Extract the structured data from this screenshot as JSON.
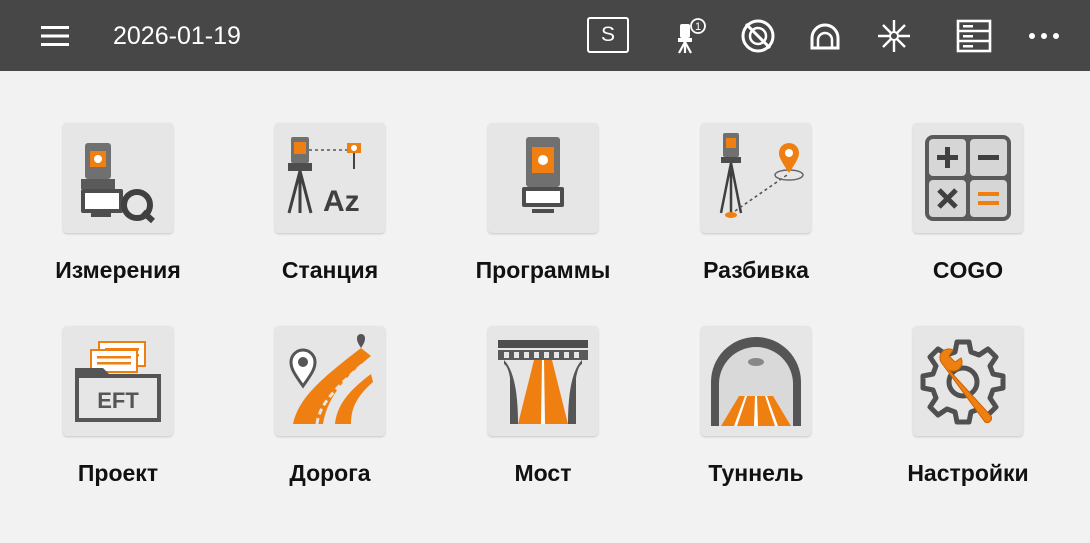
{
  "header": {
    "date": "2026-01-19",
    "s_badge": "S",
    "icons": [
      "menu-icon",
      "laser-pointer-icon",
      "compensator-off-icon",
      "prism-icon",
      "laser-plummet-icon",
      "storage-icon",
      "more-icon"
    ],
    "superscript": "1"
  },
  "tiles": [
    {
      "label": "Измерения",
      "icon": "measure-icon"
    },
    {
      "label": "Станция",
      "icon": "station-icon"
    },
    {
      "label": "Программы",
      "icon": "programs-icon"
    },
    {
      "label": "Разбивка",
      "icon": "stakeout-icon"
    },
    {
      "label": "COGO",
      "icon": "cogo-icon"
    },
    {
      "label": "Проект",
      "icon": "project-icon"
    },
    {
      "label": "Дорога",
      "icon": "road-icon"
    },
    {
      "label": "Мост",
      "icon": "bridge-icon"
    },
    {
      "label": "Туннель",
      "icon": "tunnel-icon"
    },
    {
      "label": "Настройки",
      "icon": "settings-icon"
    }
  ],
  "colors": {
    "accent": "#f07f12",
    "header_bg": "#474747",
    "page_bg": "#f2f2f2"
  }
}
